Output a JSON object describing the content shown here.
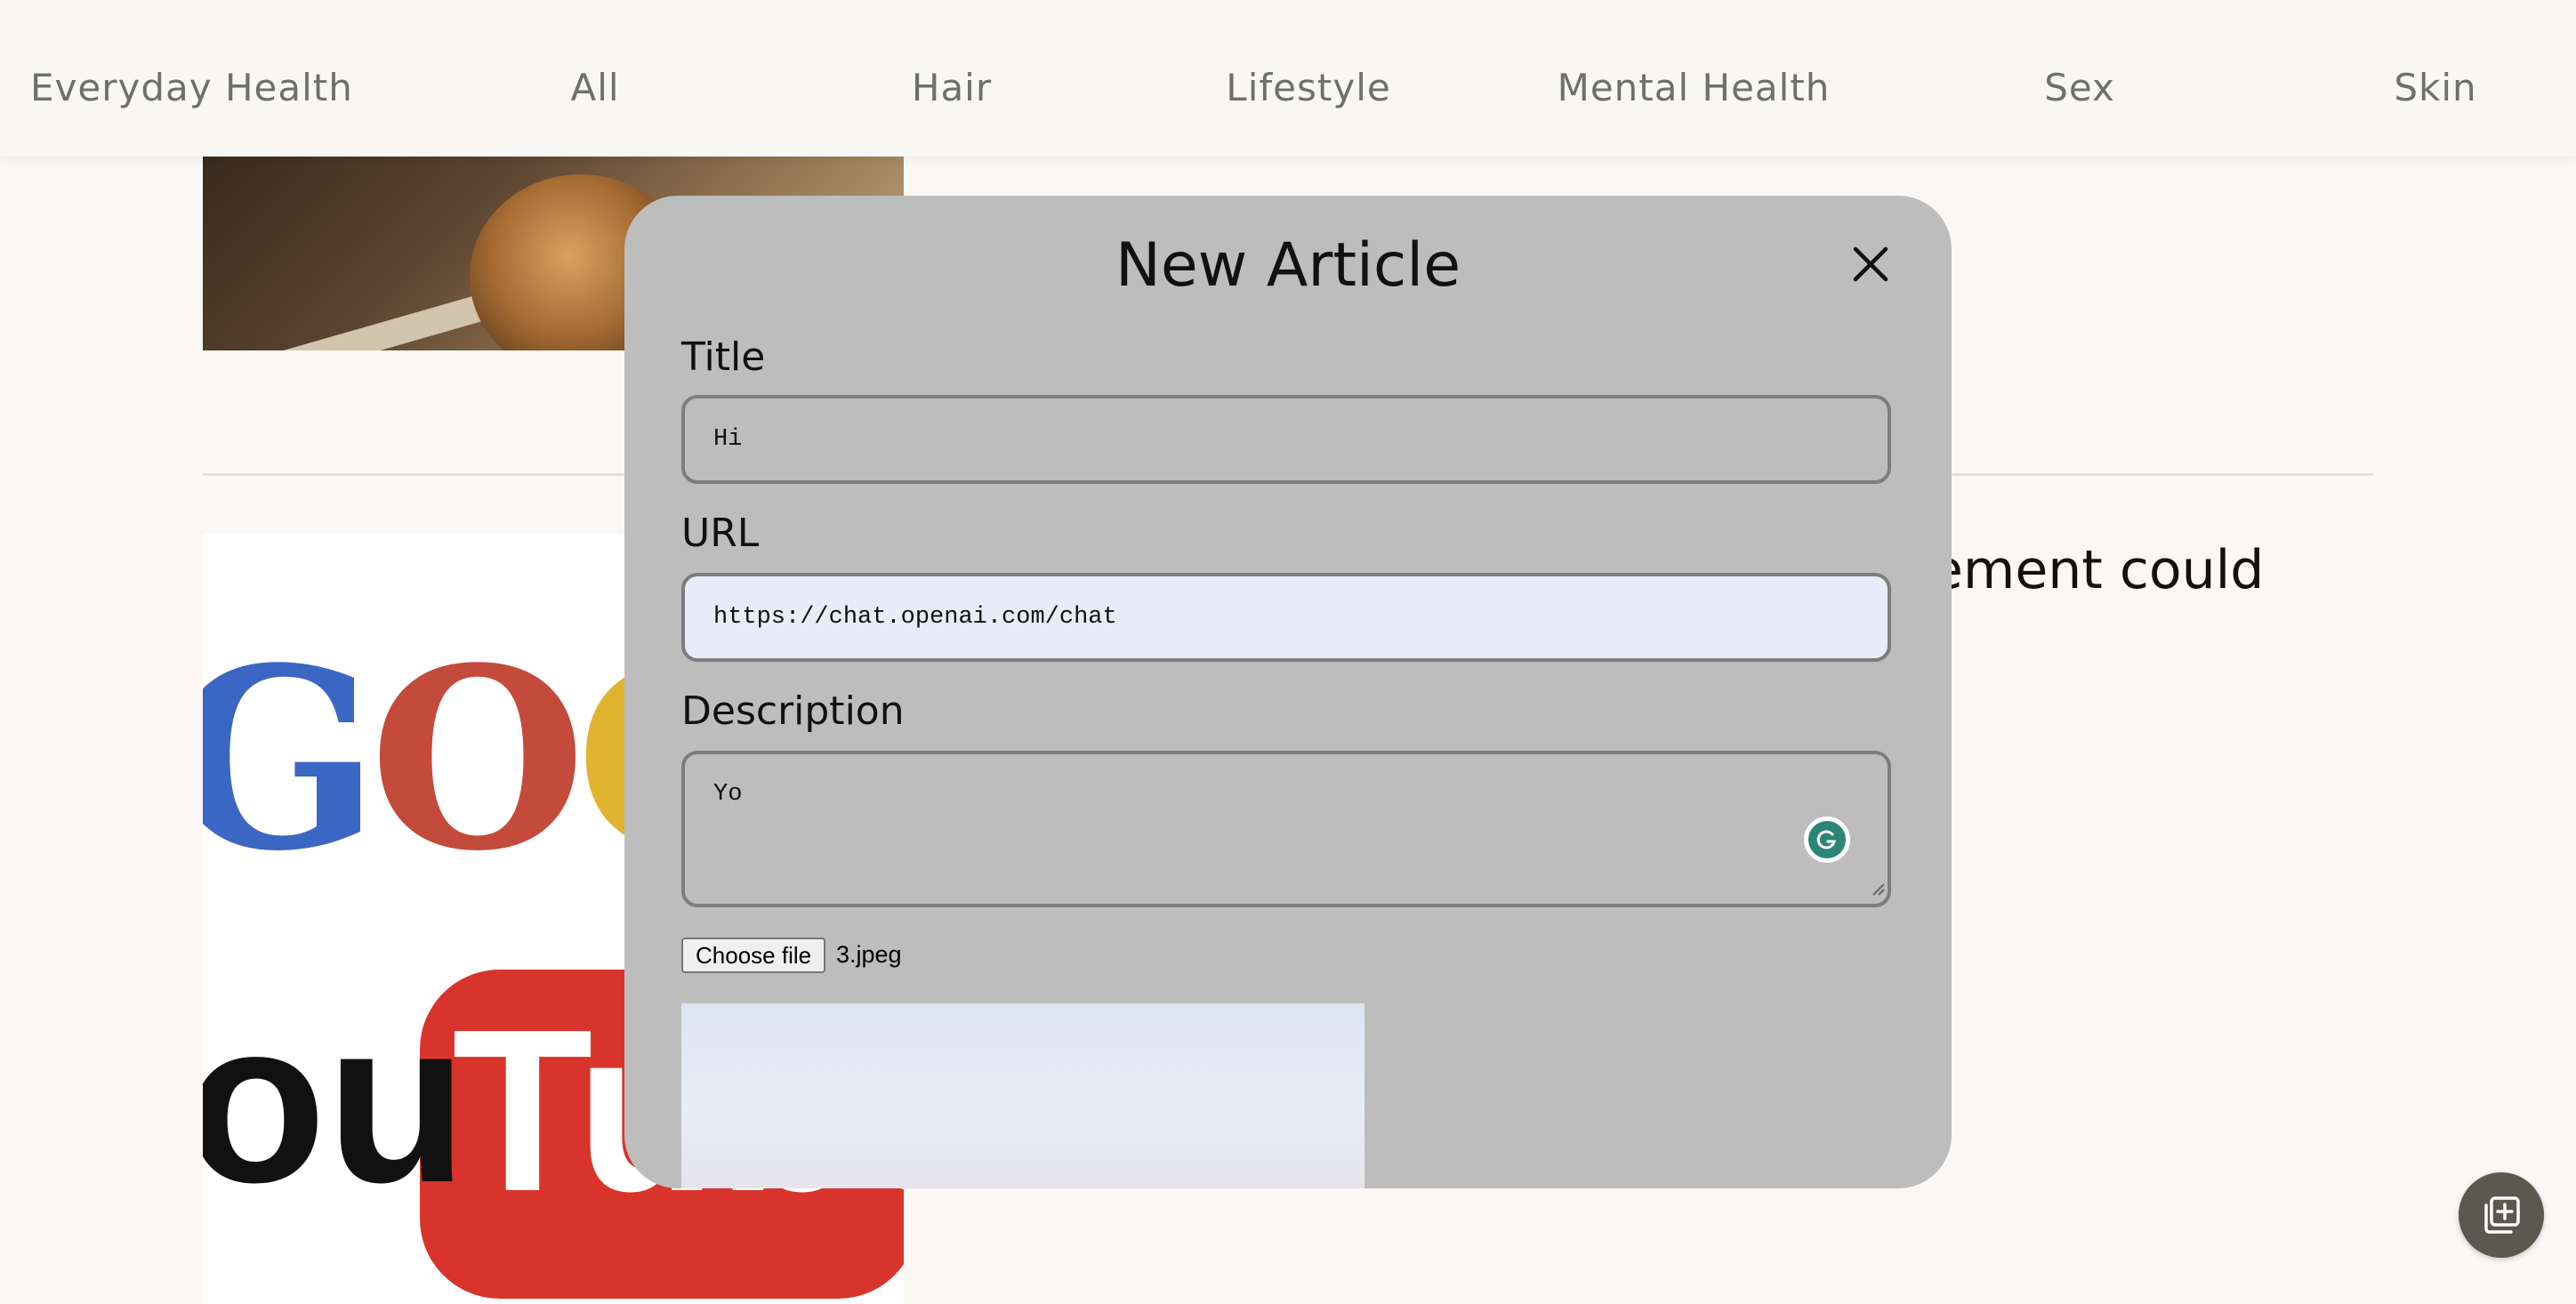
{
  "nav": {
    "brand": "Everyday Health",
    "items": [
      "All",
      "Hair",
      "Lifestyle",
      "Mental Health",
      "Sex",
      "Skin"
    ]
  },
  "background": {
    "headline_fragment": "ement could"
  },
  "modal": {
    "title": "New Article",
    "close_icon": "close-icon",
    "title_label": "Title",
    "title_value": "Hi",
    "url_label": "URL",
    "url_value": "https://chat.openai.com/chat",
    "description_label": "Description",
    "description_value": "Yo",
    "file_button": "Choose file",
    "file_name": "3.jpeg"
  },
  "fab": {
    "icon": "add-to-library-icon"
  },
  "colors": {
    "modal_bg": "#bdbdbd",
    "page_bg": "#faf7f4",
    "url_field_bg": "#e7ecf9",
    "grammarly": "#2c8576",
    "fab": "#5a584f"
  }
}
